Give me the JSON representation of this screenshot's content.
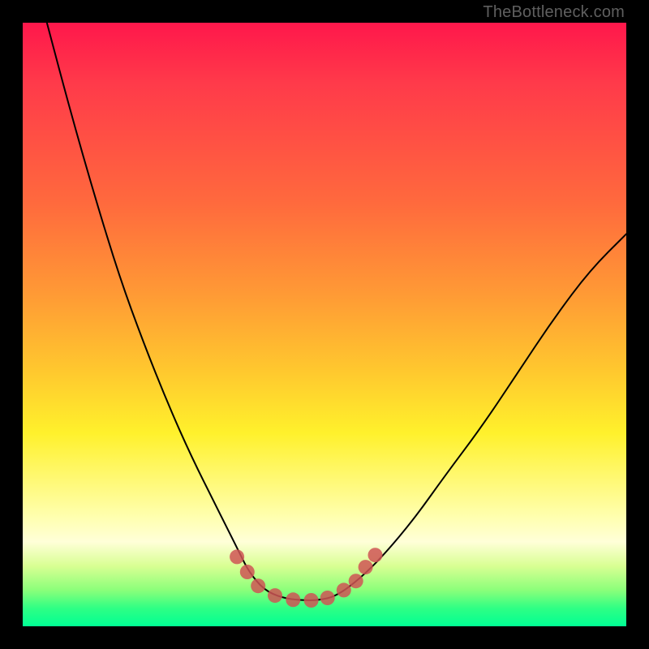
{
  "attribution": "TheBottleneck.com",
  "chart_data": {
    "type": "line",
    "title": "",
    "xlabel": "",
    "ylabel": "",
    "xlim": [
      0,
      100
    ],
    "ylim": [
      0,
      100
    ],
    "grid": false,
    "legend": false,
    "series": [
      {
        "name": "curve",
        "x": [
          4,
          8,
          12,
          16,
          20,
          24,
          28,
          32,
          34,
          36,
          37.5,
          40,
          43,
          46,
          49,
          52,
          56,
          60,
          65,
          70,
          76,
          82,
          88,
          94,
          100
        ],
        "y": [
          100,
          85,
          71,
          58,
          47,
          37,
          28,
          20,
          16,
          12,
          9,
          6,
          4.7,
          4.3,
          4.3,
          5,
          8,
          12,
          18,
          25,
          33,
          42,
          51,
          59,
          65
        ]
      }
    ],
    "markers": {
      "name": "bottom-highlight",
      "color": "#cf5555",
      "points": [
        {
          "x": 35.5,
          "y": 11.5
        },
        {
          "x": 37.2,
          "y": 9.0
        },
        {
          "x": 39.0,
          "y": 6.7
        },
        {
          "x": 41.8,
          "y": 5.1
        },
        {
          "x": 44.8,
          "y": 4.4
        },
        {
          "x": 47.8,
          "y": 4.3
        },
        {
          "x": 50.5,
          "y": 4.7
        },
        {
          "x": 53.2,
          "y": 6.0
        },
        {
          "x": 55.2,
          "y": 7.5
        },
        {
          "x": 56.8,
          "y": 9.8
        },
        {
          "x": 58.4,
          "y": 11.8
        }
      ]
    }
  }
}
